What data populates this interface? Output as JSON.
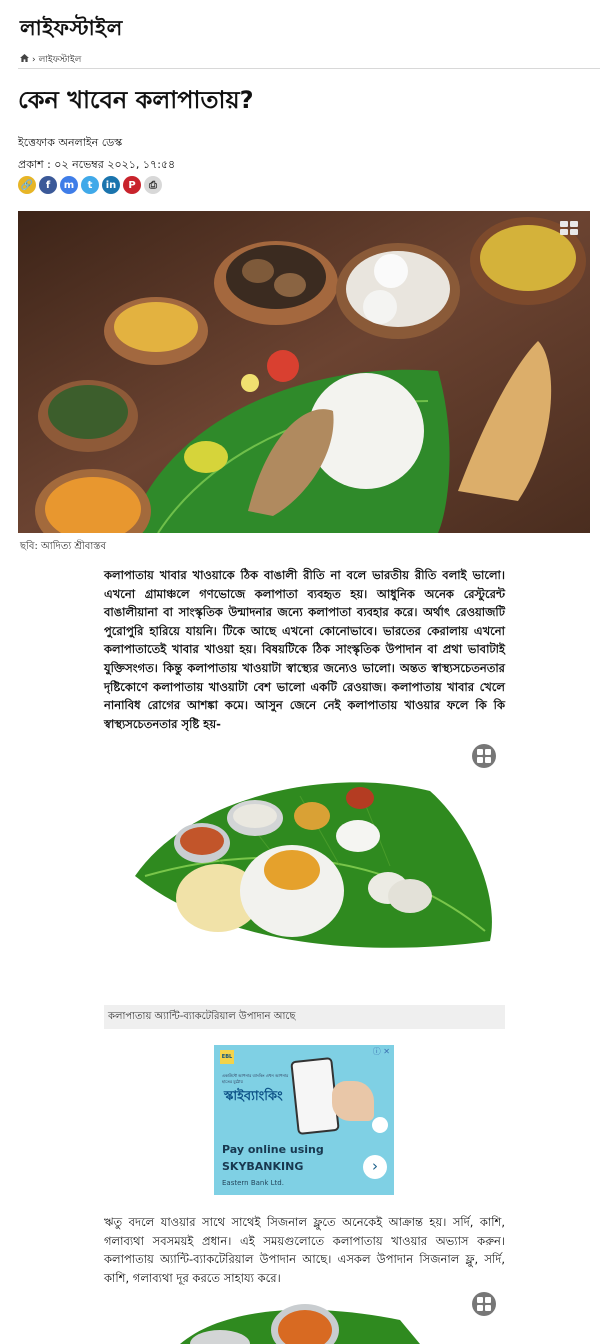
{
  "section": {
    "title": "লাইফস্টাইল"
  },
  "breadcrumb": {
    "home_icon": "home-icon",
    "separator": "›",
    "current": "লাইফস্টাইল"
  },
  "article": {
    "headline": "কেন খাবেন কলাপাতায়?",
    "author": "ইত্তেফাক অনলাইন ডেস্ক",
    "published": "প্রকাশ : ০২ নভেম্বর ২০২১, ১৭:৫৪",
    "share": [
      {
        "name": "link",
        "glyph": "🔗",
        "color": "#e7b526"
      },
      {
        "name": "facebook",
        "glyph": "f",
        "color": "#3b5998"
      },
      {
        "name": "messenger",
        "glyph": "m",
        "color": "#3f7de8"
      },
      {
        "name": "twitter",
        "glyph": "t",
        "color": "#40a9e9"
      },
      {
        "name": "linkedin",
        "glyph": "in",
        "color": "#1a74ad"
      },
      {
        "name": "pinterest",
        "glyph": "P",
        "color": "#c8232c"
      },
      {
        "name": "print",
        "glyph": "⎙",
        "color": "#d8d8d8"
      }
    ],
    "hero_caption": "ছবি: আদিত্য শ্রীবাস্তব",
    "paragraph1": "কলাপাতায় খাবার খাওয়াকে ঠিক বাঙালী রীতি না বলে ভারতীয় রীতি বলাই ভালো। এখনো গ্রামাঞ্চলে গণভোজে কলাপাতা ব্যবহৃত হয়। আধুনিক অনেক রেস্টুরেন্ট বাঙালীয়ানা বা সাংস্কৃতিক উন্মাদনার জন্যে কলাপাতা ব্যবহার করে। অর্থাৎ রেওয়াজটি পুরোপুরি হারিয়ে যায়নি। টিকে আছে এখনো কোনোভাবে। ভারতের কেরালায় এখনো কলাপাতাতেই খাবার খাওয়া হয়। বিষয়টিকে ঠিক সাংস্কৃতিক উপাদান বা প্রথা ভাবাটাই যুক্তিসংগত। কিন্তু কলাপাতায় খাওয়াটা স্বাস্থ্যের জন্যেও ভালো। অন্তত স্বাস্থ্যসচেতনতার দৃষ্টিকোণে কলাপাতায় খাওয়াটা বেশ ভালো একটি রেওয়াজ। কলাপাতায় খাবার খেলে নানাবিধ রোগের আশঙ্কা কমে। আসুন জেনে নেই কলাপাতায় খাওয়ার ফলে কি কি স্বাস্থ্যসচেতনতার সৃষ্টি হয়-",
    "image2_caption": "কলাপাতায় অ্যান্টি-ব্যাকটেরিয়াল উপাদান আছে",
    "paragraph2": "ঋতু বদলে যাওয়ার সাথে সাথেই সিজনাল ফ্লুতে অনেকেই আক্রান্ত হয়। সর্দি, কাশি, গলাব্যথা সবসময়ই প্রধান। এই সময়গুলোতে কলাপাতায় খাওয়ার অভ্যাস করুন। কলাপাতায় অ্যান্টি-ব্যাকটেরিয়াল উপাদান আছে। এসকল উপাদান সিজনাল ফ্লু, সর্দি, কাশি, গলাব্যথা দূর করতে সাহায্য করে।"
  },
  "ad": {
    "badge": "EBL",
    "headline": "স্কাইব্যাংকিং",
    "tagline": "একাউন্টে আপনার ব্যাংকিং এখন আপনার হাতের মুঠোয়",
    "text": "Pay online using",
    "brand": "SKYBANKING",
    "company": "Eastern Bank Ltd.",
    "adchoices": "ⓘ ✕"
  }
}
